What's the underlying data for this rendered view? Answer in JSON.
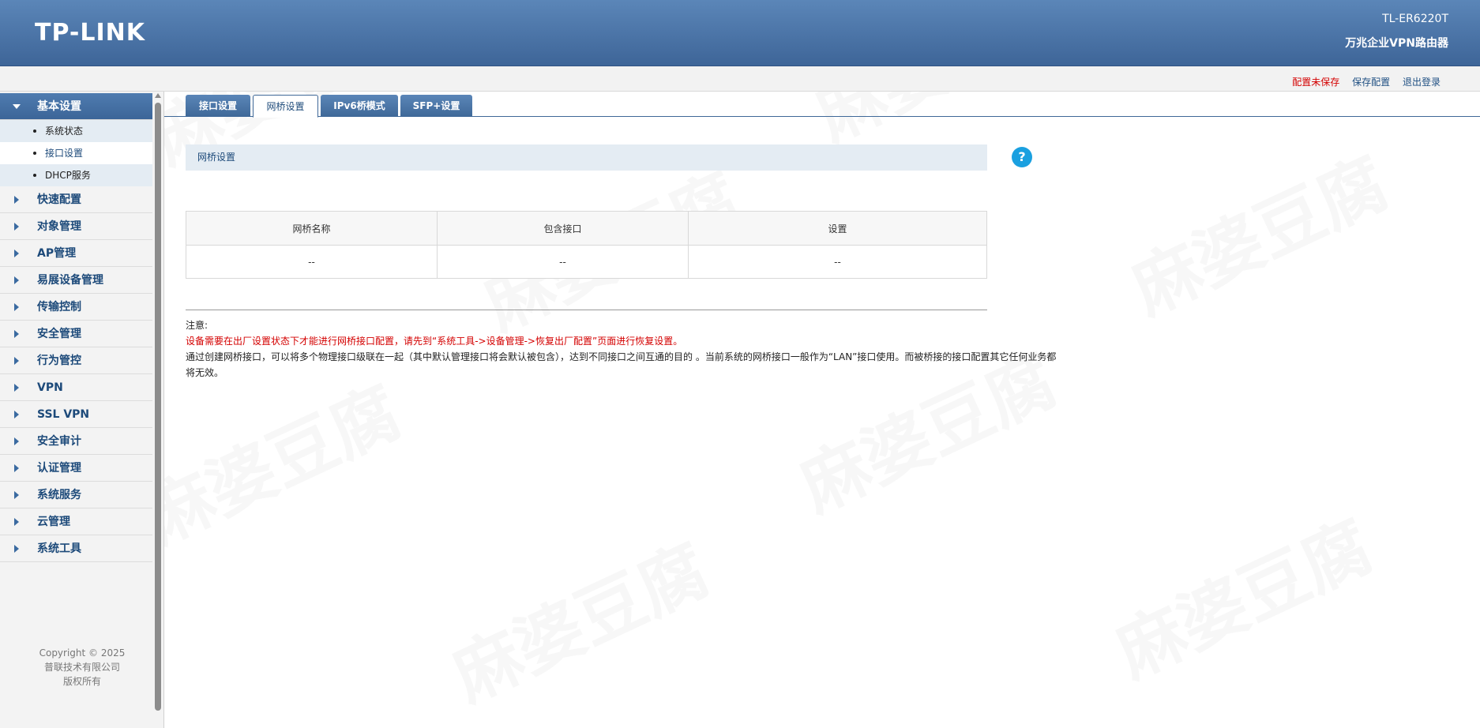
{
  "header": {
    "logo": "TP-LINK",
    "model": "TL-ER6220T",
    "product": "万兆企业VPN路由器"
  },
  "topbar": {
    "unsaved": "配置未保存",
    "save": "保存配置",
    "logout": "退出登录"
  },
  "sidebar": {
    "groups": [
      {
        "label": "基本设置",
        "expanded": true
      },
      {
        "label": "快速配置"
      },
      {
        "label": "对象管理"
      },
      {
        "label": "AP管理"
      },
      {
        "label": "易展设备管理"
      },
      {
        "label": "传输控制"
      },
      {
        "label": "安全管理"
      },
      {
        "label": "行为管控"
      },
      {
        "label": "VPN"
      },
      {
        "label": "SSL VPN"
      },
      {
        "label": "安全审计"
      },
      {
        "label": "认证管理"
      },
      {
        "label": "系统服务"
      },
      {
        "label": "云管理"
      },
      {
        "label": "系统工具"
      }
    ],
    "subitems": [
      {
        "label": "系统状态"
      },
      {
        "label": "接口设置",
        "selected": true
      },
      {
        "label": "DHCP服务"
      }
    ],
    "copyright": [
      "Copyright © 2025",
      "普联技术有限公司",
      "版权所有"
    ]
  },
  "tabs": [
    {
      "label": "接口设置"
    },
    {
      "label": "网桥设置",
      "active": true
    },
    {
      "label": "IPv6桥模式"
    },
    {
      "label": "SFP+设置"
    }
  ],
  "section": {
    "title": "网桥设置",
    "help": "?"
  },
  "table": {
    "headers": [
      "网桥名称",
      "包含接口",
      "设置"
    ],
    "rows": [
      [
        "--",
        "--",
        "--"
      ]
    ]
  },
  "note": {
    "title": "注意:",
    "warning": "设备需要在出厂设置状态下才能进行网桥接口配置，请先到“系统工具->设备管理->恢复出厂配置”页面进行恢复设置。",
    "description": "通过创建网桥接口，可以将多个物理接口级联在一起（其中默认管理接口将会默认被包含），达到不同接口之间互通的目的 。当前系统的网桥接口一般作为“LAN”接口使用。而被桥接的接口配置其它任何业务都将无效。"
  },
  "watermark": "麻婆豆腐"
}
